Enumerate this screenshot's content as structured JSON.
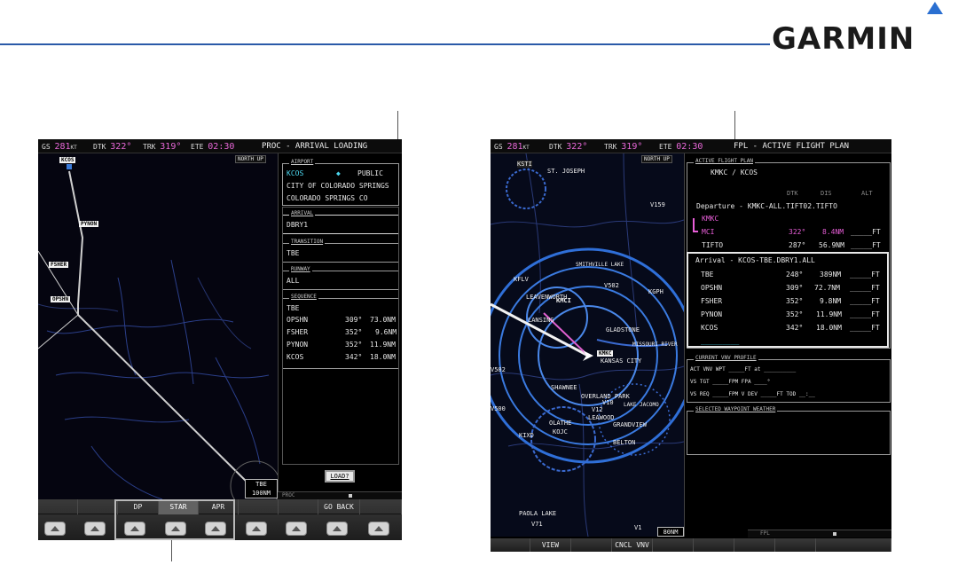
{
  "brand": {
    "name": "GARMIN"
  },
  "left_screen": {
    "status": {
      "gs_label": "GS",
      "gs": "281",
      "gs_unit": "KT",
      "dtk_label": "DTK",
      "dtk": "322°",
      "trk_label": "TRK",
      "trk": "319°",
      "ete_label": "ETE",
      "ete": "02:30"
    },
    "page_title": "PROC - ARRIVAL LOADING",
    "orientation": "NORTH UP",
    "map_labels": {
      "kcos": "KCOS",
      "pynon": "PYNON",
      "fsher": "FSHER",
      "opshn": "OPSHN"
    },
    "range_label": "TBE",
    "range_value": "100NM",
    "airport": {
      "title": "AIRPORT",
      "ident": "KCOS",
      "type": "PUBLIC",
      "city": "CITY OF COLORADO SPRINGS",
      "state": "COLORADO SPRINGS CO"
    },
    "arrival": {
      "title": "ARRIVAL",
      "value": "DBRY1"
    },
    "transition": {
      "title": "TRANSITION",
      "value": "TBE"
    },
    "runway": {
      "title": "RUNWAY",
      "value": "ALL"
    },
    "sequence": {
      "title": "SEQUENCE",
      "first": "TBE",
      "rows": [
        {
          "wpt": "OPSHN",
          "dtk": "309°",
          "dis": "73.0NM"
        },
        {
          "wpt": "FSHER",
          "dtk": "352°",
          "dis": "9.6NM"
        },
        {
          "wpt": "PYNON",
          "dtk": "352°",
          "dis": "11.9NM"
        },
        {
          "wpt": "KCOS",
          "dtk": "342°",
          "dis": "18.0NM"
        }
      ]
    },
    "load_button": "LOAD?",
    "footer_left": "PROC",
    "softkeys": [
      "",
      "",
      "DP",
      "STAR",
      "APR",
      "",
      "",
      "GO BACK",
      ""
    ]
  },
  "right_screen": {
    "status": {
      "gs_label": "GS",
      "gs": "281",
      "gs_unit": "KT",
      "dtk_label": "DTK",
      "dtk": "322°",
      "trk_label": "TRK",
      "trk": "319°",
      "ete_label": "ETE",
      "ete": "02:30"
    },
    "page_title": "FPL - ACTIVE FLIGHT PLAN",
    "orientation": "NORTH UP",
    "map_labels": {
      "ksti": "KSTI",
      "st_joseph": "ST. JOSEPH",
      "v159": "V159",
      "kflv": "KFLV",
      "leavenworth": "LEAVENWORTH",
      "kmci": "KMCI",
      "lansing": "LANSING",
      "smithville": "SMITHVILLE LAKE",
      "v502": "V502",
      "kgpk": "KGPH",
      "gladstone": "GLADSTONE",
      "kmkc": "KMKC",
      "kansas_city": "KANSAS CITY",
      "missouri": "MISSOURI RIVER",
      "shawnee": "SHAWNEE",
      "overland": "OVERLAND PARK",
      "v12": "V12",
      "v10": "V10",
      "lake": "LAKE JACOMO",
      "v500": "V500",
      "lenexa": "LEAWOOD",
      "olathe": "OLATHE",
      "kojc": "KOJC",
      "grandview": "GRANDVIEW",
      "kixd": "KIXD",
      "belton": "BELTON",
      "paola": "PAOLA LAKE",
      "v71": "V71",
      "v1": "V1",
      "v502w": "V502",
      "v12b": "V12"
    },
    "range_value": "80NM",
    "fpl": {
      "title": "ACTIVE FLIGHT PLAN",
      "route": "KMKC / KCOS",
      "col_dtk": "DTK",
      "col_dis": "DIS",
      "col_alt": "ALT",
      "departure": "Departure - KMKC-ALL.TIFT02.TIFTO",
      "dep_rows": [
        {
          "wpt": "KMKC",
          "dtk": "",
          "dis": "",
          "alt": ""
        },
        {
          "wpt": "MCI",
          "dtk": "322°",
          "dis": "8.4NM",
          "alt": "_____FT"
        },
        {
          "wpt": "TIFTO",
          "dtk": "287°",
          "dis": "56.9NM",
          "alt": "_____FT"
        }
      ],
      "arrival": "Arrival - KCOS-TBE.DBRY1.ALL",
      "arr_rows": [
        {
          "wpt": "TBE",
          "dtk": "248°",
          "dis": "389NM",
          "alt": "_____FT"
        },
        {
          "wpt": "OPSHN",
          "dtk": "309°",
          "dis": "72.7NM",
          "alt": "_____FT"
        },
        {
          "wpt": "FSHER",
          "dtk": "352°",
          "dis": "9.8NM",
          "alt": "_____FT"
        },
        {
          "wpt": "PYNON",
          "dtk": "352°",
          "dis": "11.9NM",
          "alt": "_____FT"
        },
        {
          "wpt": "KCOS",
          "dtk": "342°",
          "dis": "18.0NM",
          "alt": "_____FT"
        }
      ],
      "blank": "_________"
    },
    "vnv": {
      "title": "CURRENT VNV PROFILE",
      "line1": "ACT VNV WPT  _____FT  at  __________",
      "line2": "VS TGT   _____FPM   FPA   ____°",
      "line3": "VS REQ   _____FPM   V DEV  _____FT   TOD  __:__"
    },
    "wx": {
      "title": "SELECTED WAYPOINT WEATHER"
    },
    "footer_right": "FPL",
    "softkeys": [
      "",
      "VIEW",
      "",
      "CNCL VNV",
      "",
      "",
      "",
      "",
      ""
    ]
  }
}
